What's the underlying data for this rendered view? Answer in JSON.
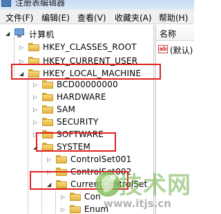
{
  "window": {
    "title": "注册表编辑器"
  },
  "menu": [
    "文件(F)",
    "编辑(E)",
    "查看(V)",
    "收藏夹(A)",
    "帮助(H)"
  ],
  "tree": {
    "root": "计算机",
    "hives": [
      "HKEY_CLASSES_ROOT",
      "HKEY_CURRENT_USER",
      "HKEY_LOCAL_MACHINE"
    ],
    "hklm_children": [
      "BCD00000000",
      "HARDWARE",
      "SAM",
      "SECURITY",
      "SOFTWARE",
      "SYSTEM"
    ],
    "system_children": [
      "ControlSet001",
      "ControlSet002",
      "CurrentControlSet"
    ],
    "current_children": [
      "Con",
      "Enum"
    ]
  },
  "list": {
    "header_name": "名称",
    "default_value": "(默认)",
    "value_icon": "ab"
  },
  "watermark": {
    "brand": "技术网",
    "url": "www.itjs.cn"
  },
  "colors": {
    "highlight": "#e02020",
    "folder": "#f2cc5c"
  }
}
